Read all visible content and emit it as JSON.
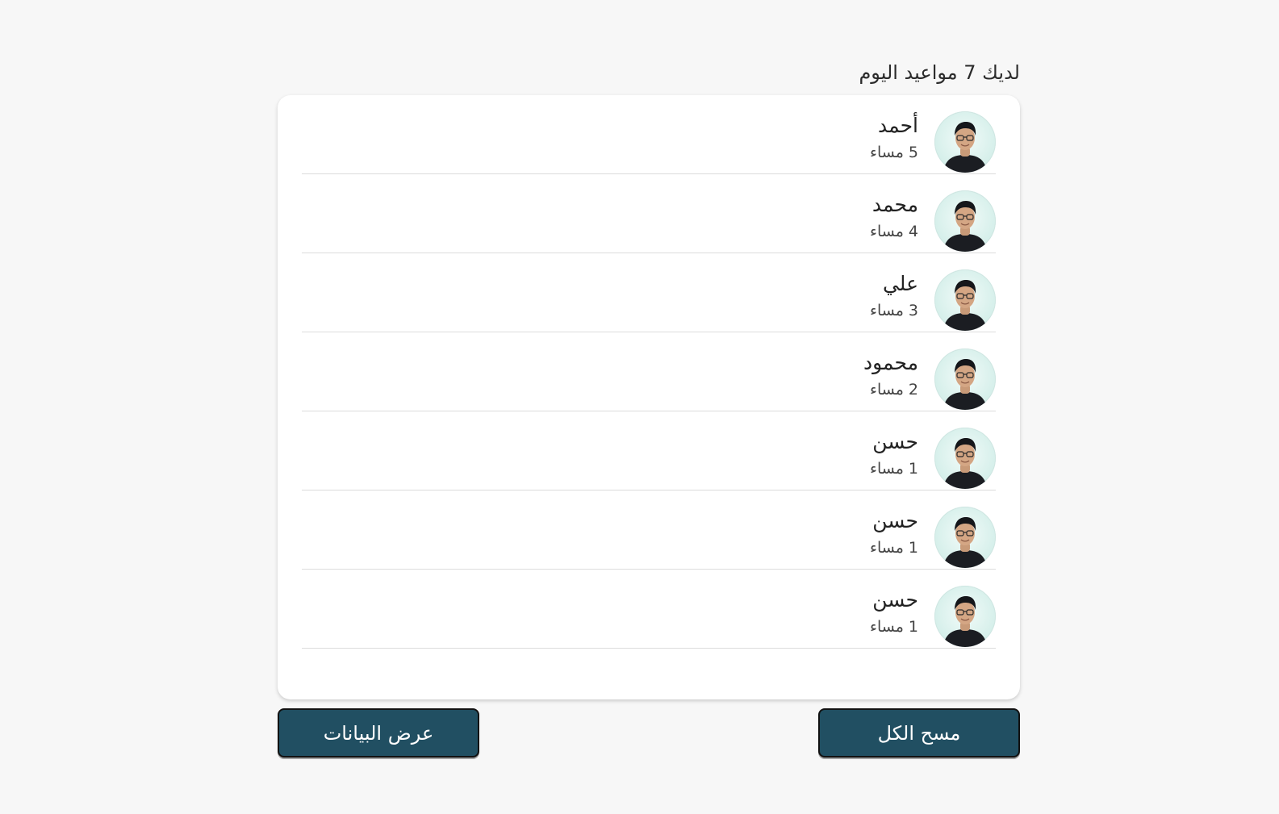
{
  "header": {
    "title": "لديك 7 مواعيد اليوم"
  },
  "appointments": [
    {
      "name": "أحمد",
      "time": "5 مساء"
    },
    {
      "name": "محمد",
      "time": "4 مساء"
    },
    {
      "name": "علي",
      "time": "3 مساء"
    },
    {
      "name": "محمود",
      "time": "2 مساء"
    },
    {
      "name": "حسن",
      "time": "1 مساء"
    },
    {
      "name": "حسن",
      "time": "1 مساء"
    },
    {
      "name": "حسن",
      "time": "1 مساء"
    }
  ],
  "actions": {
    "clear_all_label": "مسح الكل",
    "view_data_label": "عرض البيانات"
  },
  "colors": {
    "background": "#f7f7f7",
    "card": "#ffffff",
    "button": "#214f62",
    "button_text": "#ffffff",
    "avatar_bg": "#d5efea"
  },
  "icons": {
    "avatar": "person-photo-avatar"
  }
}
